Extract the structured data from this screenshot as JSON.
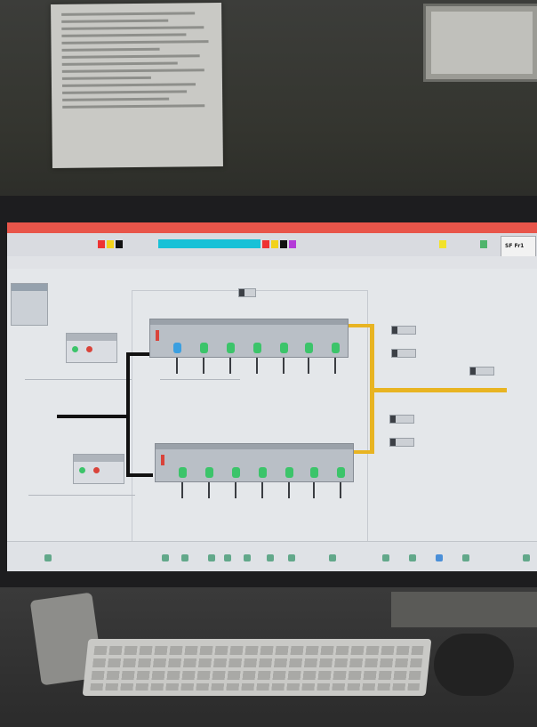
{
  "photo": {
    "scene": "monitor",
    "screen_app": {
      "toolbar": {
        "left_text": "",
        "center_text": "",
        "right_label": "SF Fr1"
      },
      "colors": {
        "titlebar": "#e8554a",
        "highlight": "#18c1d7",
        "pipe_yellow": "#e8b422",
        "pipe_black": "#111111",
        "led_green": "#3cc46a",
        "led_red": "#d9433a"
      },
      "schematic": {
        "banks": [
          {
            "valves": [
              "blue",
              "green",
              "green",
              "green",
              "green",
              "green",
              "green"
            ]
          },
          {
            "valves": [
              "green",
              "green",
              "green",
              "green",
              "green",
              "green",
              "green"
            ]
          }
        ],
        "controls": [
          {
            "leds": [
              "green",
              "red"
            ]
          },
          {
            "leds": [
              "green",
              "red"
            ]
          }
        ]
      },
      "taskbar": {
        "icons": 14
      }
    }
  }
}
